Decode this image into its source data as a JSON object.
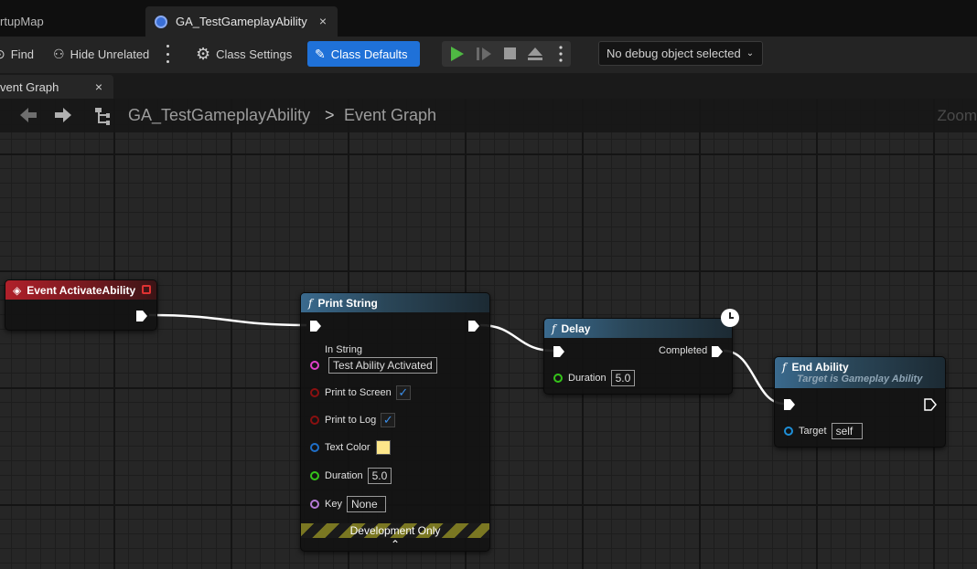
{
  "tabs": {
    "inactive_label": "rtupMap",
    "active_label": "GA_TestGameplayAbility",
    "close_glyph": "×"
  },
  "toolbar": {
    "find_label": "Find",
    "hide_unrelated_label": "Hide Unrelated",
    "class_settings_label": "Class Settings",
    "class_defaults_label": "Class Defaults",
    "debug_select_value": "No debug object selected",
    "accent_color": "#1f71d8",
    "play_color": "#4fb843"
  },
  "doc_tab": {
    "label": "vent Graph",
    "close_glyph": "×"
  },
  "breadcrumb": {
    "asset": "GA_TestGameplayAbility",
    "separator": ">",
    "graph": "Event Graph",
    "zoom": "Zoom"
  },
  "nodes": {
    "event": {
      "title": "Event ActivateAbility",
      "header_color": "#b0202a"
    },
    "print_string": {
      "title": "Print String",
      "in_string_label": "In String",
      "in_string_value": "Test Ability Activated",
      "print_to_screen_label": "Print to Screen",
      "print_to_log_label": "Print to Log",
      "text_color_label": "Text Color",
      "text_color_value": "#fde68a",
      "duration_label": "Duration",
      "duration_value": "5.0",
      "key_label": "Key",
      "key_value": "None",
      "dev_only_label": "Development Only"
    },
    "delay": {
      "title": "Delay",
      "completed_label": "Completed",
      "duration_label": "Duration",
      "duration_value": "5.0"
    },
    "end_ability": {
      "title": "End Ability",
      "subtitle": "Target is Gameplay Ability",
      "target_label": "Target",
      "target_value": "self"
    }
  },
  "pin_colors": {
    "string": "#e040c8",
    "bool": "#8a1010",
    "struct": "#1f6fc8",
    "float": "#35c41a",
    "name": "#b57ad6",
    "object": "#1e8fd8"
  }
}
